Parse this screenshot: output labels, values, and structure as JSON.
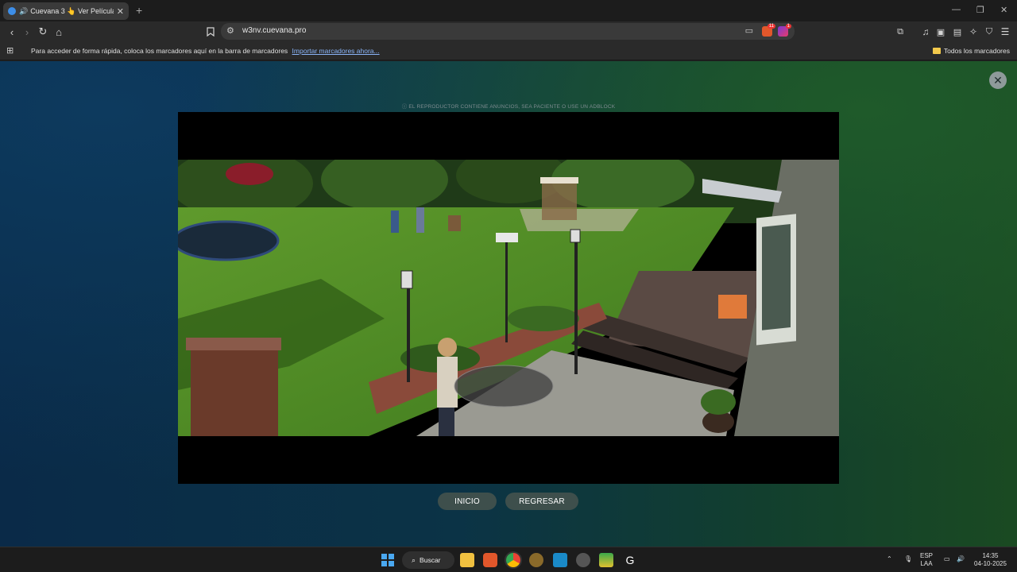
{
  "browser": {
    "tab": {
      "title": "Cuevana 3 👆 Ver Películas o",
      "audio_icon": "speaker-icon"
    },
    "url": "w3nv.cuevana.pro",
    "bookmarks_bar": {
      "message": "Para acceder de forma rápida, coloca los marcadores aquí en la barra de marcadores",
      "import_link": "Importar marcadores ahora...",
      "all_bookmarks": "Todos los marcadores"
    },
    "extension_badges": {
      "brave_shield": "11",
      "rewards": "1"
    }
  },
  "page": {
    "ad_notice": "ⓘ EL REPRODUCTOR CONTIENE ANUNCIOS, SEA PACIENTE O USE UN ADBLOCK",
    "buttons": {
      "home": "INICIO",
      "back": "REGRESAR"
    },
    "colors": {
      "pill_bg": "#3e4f4c",
      "close_bg": "#8e9a9a"
    }
  },
  "taskbar": {
    "search_label": "Buscar",
    "language": {
      "lang": "ESP",
      "layout": "LAA"
    },
    "clock": {
      "time": "14:35",
      "date": "04-10-2025"
    }
  }
}
